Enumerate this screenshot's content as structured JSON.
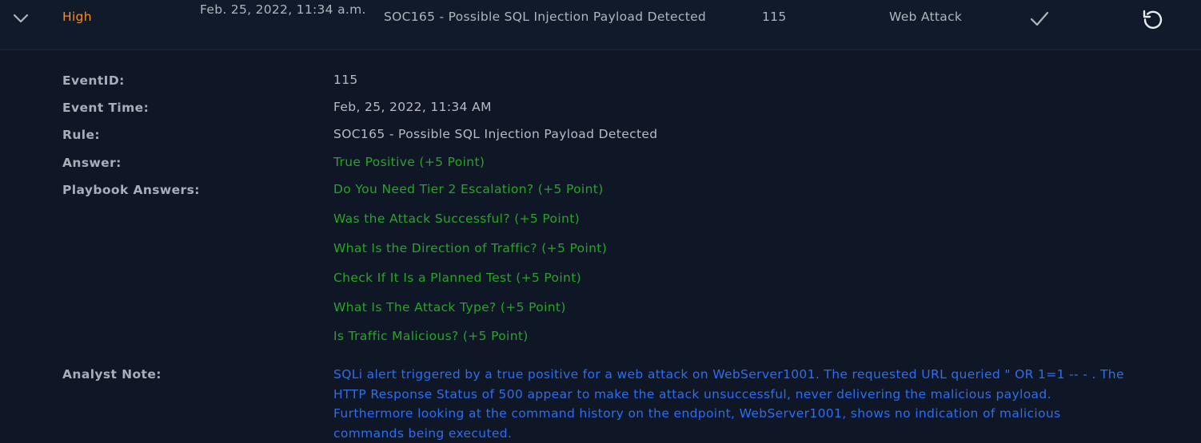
{
  "alert_row": {
    "severity": "High",
    "date": "Feb. 25, 2022, 11:34 a.m.",
    "rule": "SOC165 - Possible SQL Injection Payload Detected",
    "event_id": "115",
    "type": "Web Attack",
    "icons": {
      "expand": "chevron-down-icon",
      "status": "check-icon",
      "action": "restore-icon"
    }
  },
  "details": {
    "event_id": {
      "label": "EventID:",
      "value": "115"
    },
    "event_time": {
      "label": "Event Time:",
      "value": "Feb, 25, 2022, 11:34 AM"
    },
    "rule": {
      "label": "Rule:",
      "value": "SOC165 - Possible SQL Injection Payload Detected"
    },
    "answer": {
      "label": "Answer:",
      "value": "True Positive (+5 Point)"
    },
    "playbook": {
      "label": "Playbook Answers:",
      "answers": [
        "Do You Need Tier 2 Escalation? (+5 Point)",
        "Was the Attack Successful? (+5 Point)",
        "What Is the Direction of Traffic? (+5 Point)",
        "Check If It Is a Planned Test (+5 Point)",
        "What Is The Attack Type? (+5 Point)",
        "Is Traffic Malicious? (+5 Point)"
      ]
    },
    "analyst_note": {
      "label": "Analyst Note:",
      "value": "SQLi alert triggered by a true positive for a web attack on WebServer1001. The requested URL queried \" OR 1=1 -- - . The HTTP Response Status of 500 appear to make the attack unsuccessful, never delivering the malicious payload. Furthermore looking at the command history on the endpoint, WebServer1001, shows no indication of malicious commands being executed."
    }
  },
  "colors": {
    "severity_high": "#f0902c",
    "positive": "#2aa32a",
    "note": "#2d6ef0",
    "background": "#0f1626"
  }
}
